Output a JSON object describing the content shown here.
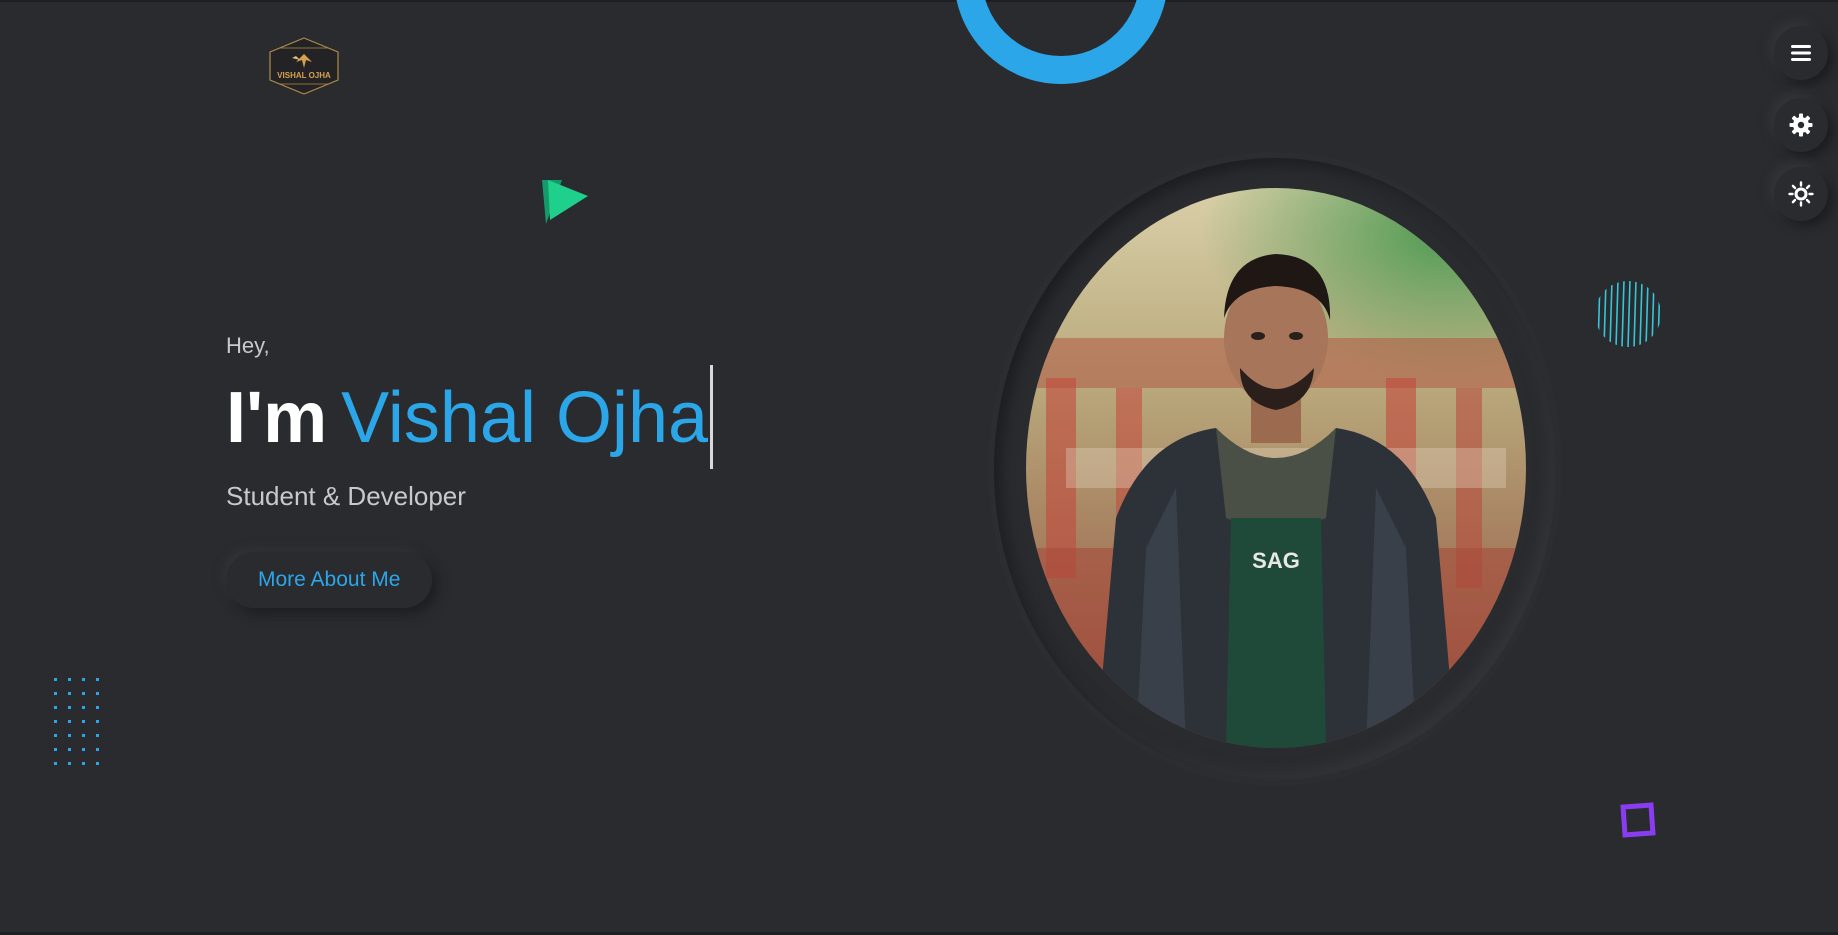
{
  "logo": {
    "text": "VISHAL OJHA"
  },
  "hero": {
    "greeting": "Hey,",
    "prefix": "I'm",
    "name": "Vishal Ojha",
    "role": "Student & Developer",
    "cta_label": "More About Me"
  },
  "side_buttons": {
    "menu_icon": "menu-icon",
    "settings_icon": "gear-icon",
    "theme_icon": "sun-icon"
  },
  "portrait": {
    "shirt_text": "SAG"
  },
  "colors": {
    "background": "#2a2b2f",
    "accent_blue": "#2ba6e8",
    "triangle_green": "#1fcf8c",
    "stripes_cyan": "#35c6d8",
    "square_purple": "#8a3df0"
  }
}
